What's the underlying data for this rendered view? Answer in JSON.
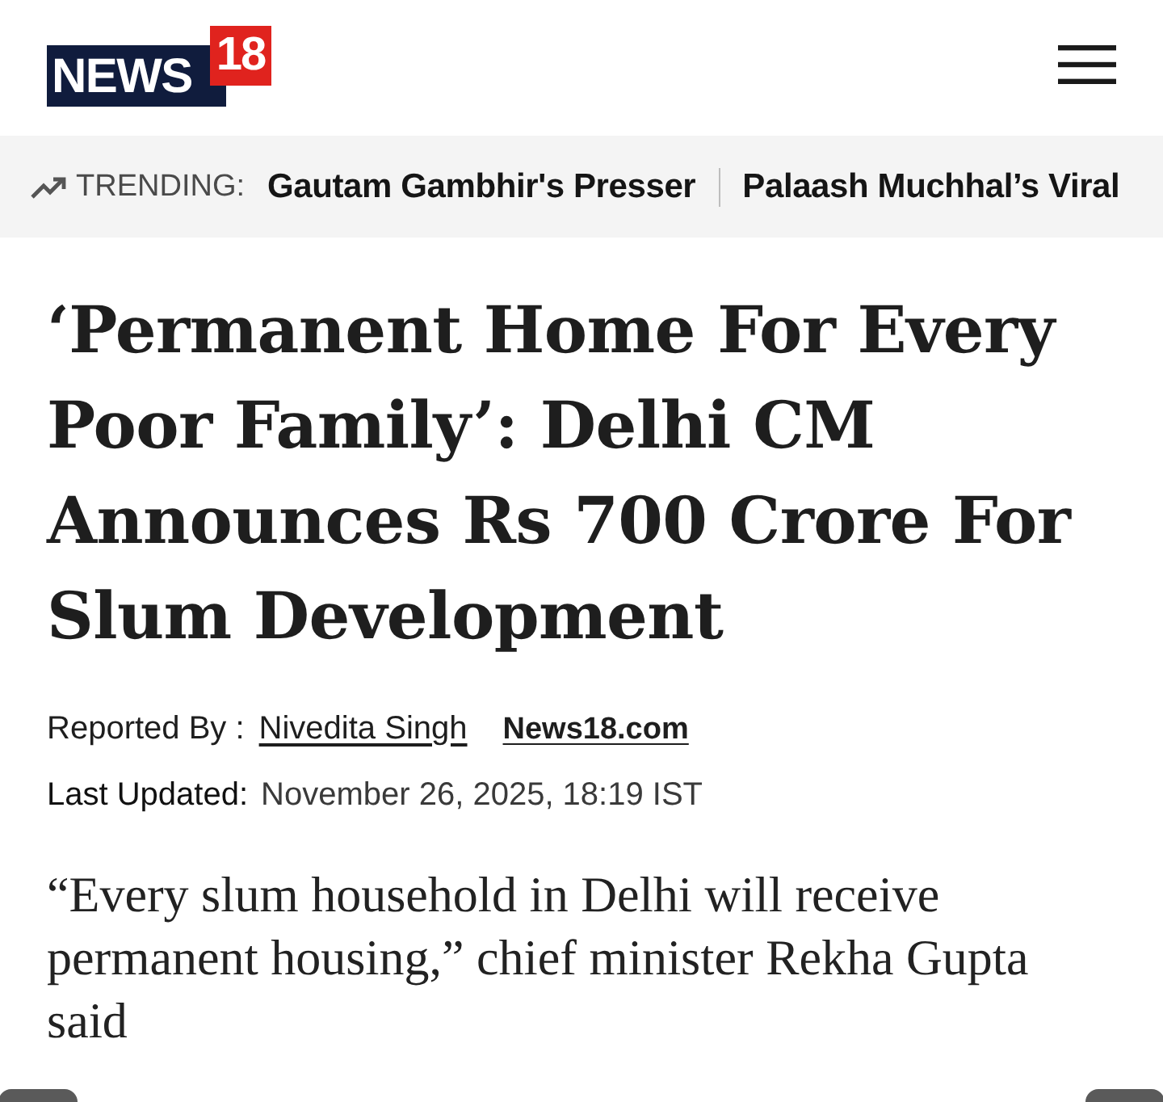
{
  "header": {
    "logo": {
      "word": "NEWS",
      "number": "18"
    }
  },
  "trending": {
    "label": "TRENDING:",
    "items": [
      "Gautam Gambhir's Presser",
      "Palaash Muchhal’s Viral"
    ]
  },
  "article": {
    "headline": "‘Permanent Home For Every Poor Family’: Delhi CM Announces Rs 700 Crore For Slum Development",
    "byline": {
      "label": "Reported By :",
      "author": "Nivedita Singh",
      "source": "News18.com"
    },
    "updated": {
      "label": "Last Updated:",
      "value": "November 26, 2025, 18:19 IST"
    },
    "lede": "“Every slum household in Delhi will receive permanent housing,” chief minister Rekha Gupta said"
  }
}
